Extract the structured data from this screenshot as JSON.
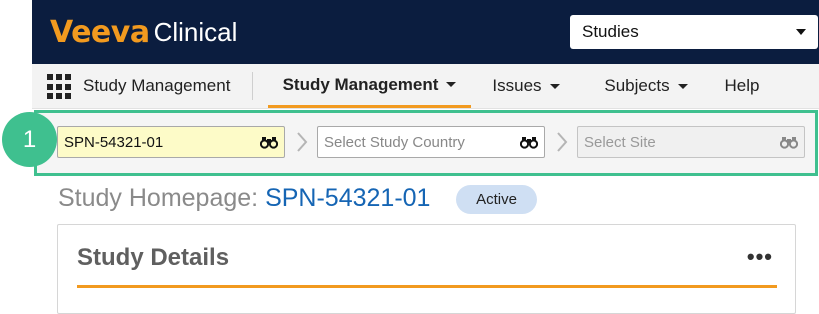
{
  "brand": {
    "name_part1": "Veeva",
    "name_part2": "Clinical"
  },
  "app_selector": {
    "value": "Studies"
  },
  "nav": {
    "app_name": "Study Management",
    "items": [
      {
        "label": "Study Management",
        "active": true,
        "dropdown": true
      },
      {
        "label": "Issues",
        "active": false,
        "dropdown": true
      },
      {
        "label": "Subjects",
        "active": false,
        "dropdown": true
      },
      {
        "label": "Help",
        "active": false,
        "dropdown": false
      }
    ]
  },
  "callout": {
    "number": "1"
  },
  "selectors": {
    "study": {
      "value": "SPN-54321-01"
    },
    "country": {
      "placeholder": "Select Study Country"
    },
    "site": {
      "placeholder": "Select Site"
    }
  },
  "page": {
    "title_prefix": "Study Homepage:",
    "study_code": "SPN-54321-01",
    "status": "Active"
  },
  "card": {
    "title": "Study Details",
    "menu": "•••"
  },
  "colors": {
    "header_bg": "#0b1d3f",
    "brand_orange": "#f29a1f",
    "highlight_green": "#3fc08f",
    "link_blue": "#1565b4",
    "badge_bg": "#cfdff3"
  },
  "icons": {
    "lookup": "binoculars-icon",
    "separator": "chevron-right-icon",
    "app_menu": "grid-icon"
  }
}
